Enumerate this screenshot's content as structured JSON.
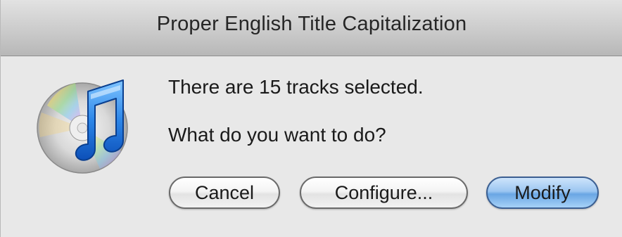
{
  "dialog": {
    "title": "Proper English Title Capitalization",
    "app_icon": "itunes-icon",
    "message_line_1": "There are 15 tracks selected.",
    "message_line_2": "What do you want to do?",
    "buttons": {
      "cancel_label": "Cancel",
      "configure_label": "Configure...",
      "modify_label": "Modify"
    },
    "default_button": "Modify",
    "colors": {
      "default_button_accent": "#6aa6e4",
      "window_background": "#e8e8e8"
    }
  }
}
